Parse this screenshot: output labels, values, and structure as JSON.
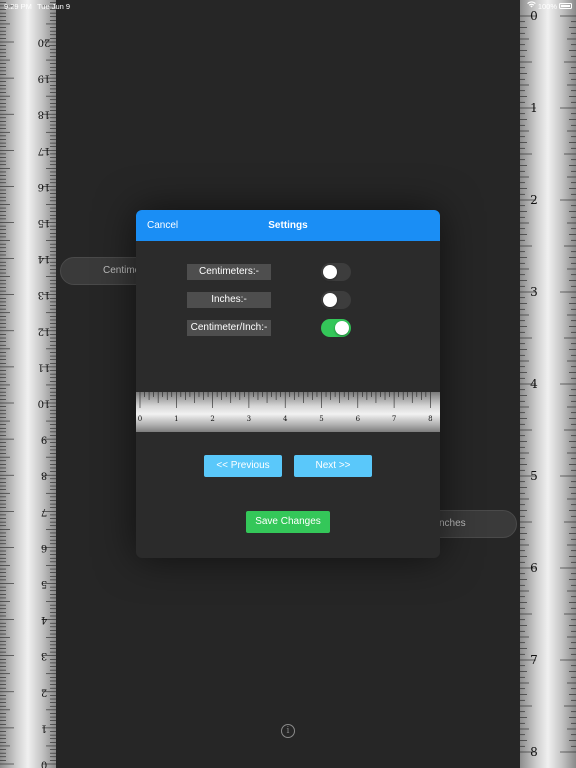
{
  "status_bar": {
    "time": "9:29 PM",
    "date": "Tue Jun 9",
    "battery": "100%"
  },
  "left_ruler": {
    "unit": "cm",
    "labels": [
      "0",
      "1",
      "2",
      "3",
      "4",
      "5",
      "6",
      "7",
      "8",
      "9",
      "10",
      "11",
      "12",
      "13",
      "14",
      "15",
      "16",
      "17",
      "18",
      "19",
      "20"
    ]
  },
  "right_ruler": {
    "unit": "inch",
    "labels": [
      "0",
      "1",
      "2",
      "3",
      "4",
      "5",
      "6",
      "7",
      "8"
    ]
  },
  "background": {
    "left_pill": "Centime",
    "right_pill": "nches",
    "info_icon": "i"
  },
  "modal": {
    "cancel_label": "Cancel",
    "title": "Settings",
    "options": [
      {
        "label": "Centimeters:-",
        "enabled": false
      },
      {
        "label": "Inches:-",
        "enabled": false
      },
      {
        "label": "Centimeter/Inch:-",
        "enabled": true
      }
    ],
    "preview_ruler_labels": [
      "0",
      "1",
      "2",
      "3",
      "4",
      "5",
      "6",
      "7",
      "8"
    ],
    "prev_label": "<< Previous",
    "next_label": "Next >>",
    "save_label": "Save Changes"
  },
  "colors": {
    "header_blue": "#1a8ef5",
    "nav_button": "#5ac8fa",
    "save_green": "#34c759",
    "toggle_on": "#34c759"
  }
}
